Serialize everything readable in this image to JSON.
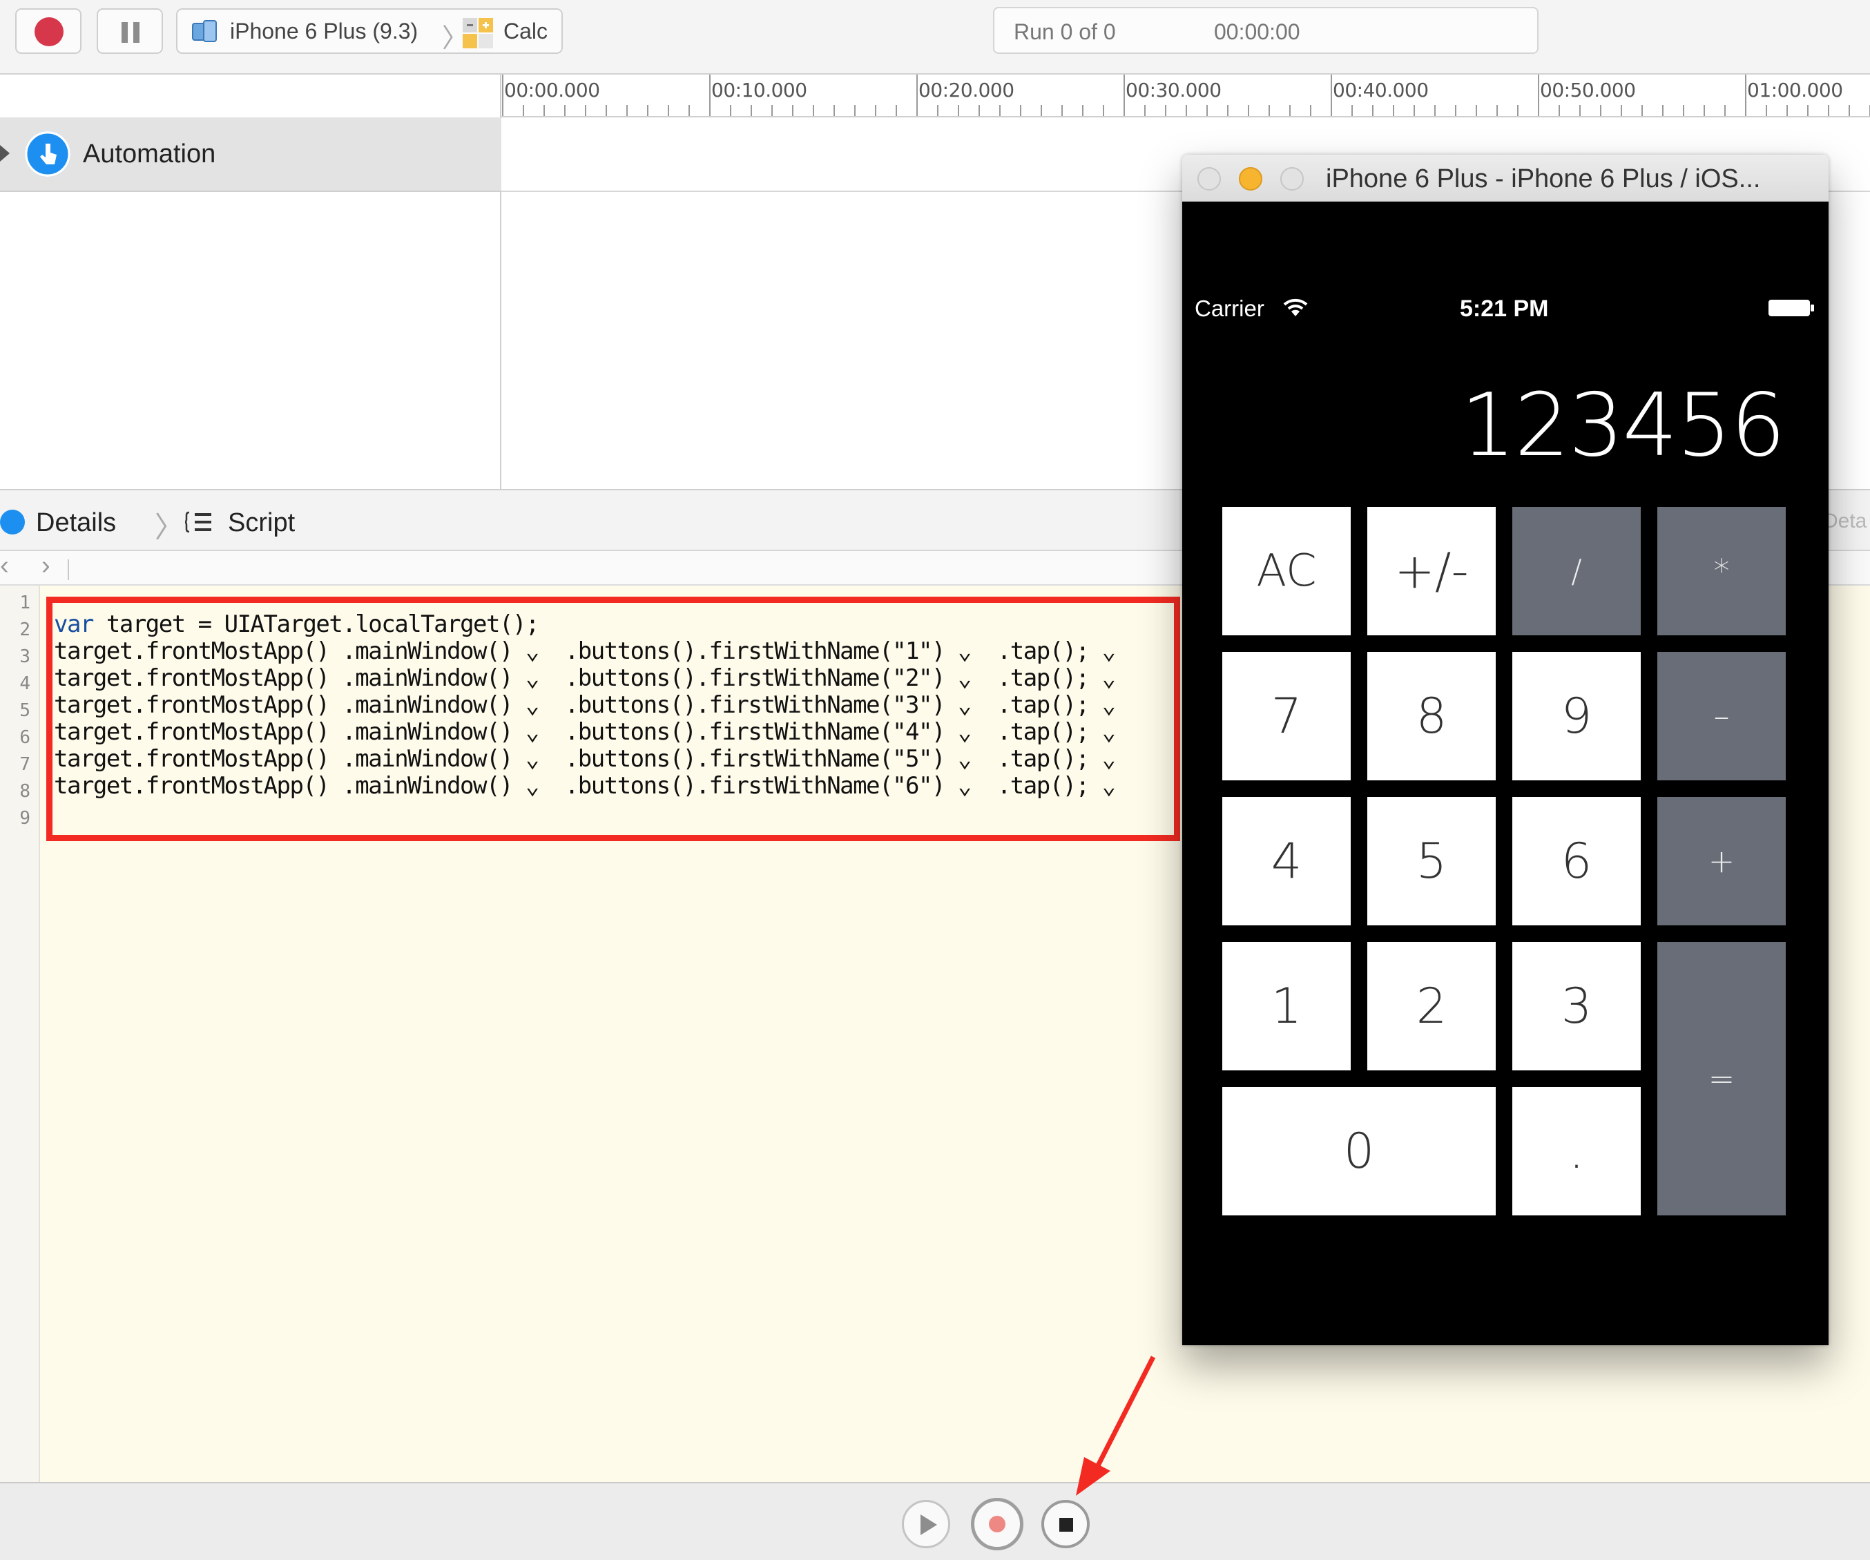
{
  "toolbar": {
    "device_label": "iPhone 6 Plus (9.3)",
    "app_label": "Calc",
    "separator": "〉",
    "run_status": "Run 0 of 0",
    "elapsed_time": "00:00:00"
  },
  "timeline": {
    "ticks": [
      "00:00.000",
      "00:10.000",
      "00:20.000",
      "00:30.000",
      "00:40.000",
      "00:50.000",
      "01:00.000"
    ],
    "instrument_label": "Automation"
  },
  "details_bar": {
    "details_label": "Details",
    "chevron": "〉",
    "script_label": "Script",
    "partial_right_label": "Deta",
    "back_glyph": "‹",
    "forward_glyph": "›"
  },
  "editor": {
    "line_numbers": [
      "1",
      "2",
      "3",
      "4",
      "5",
      "6",
      "7",
      "8",
      "9"
    ],
    "keyword": "var",
    "line2_rest": " target = UIATarget.localTarget();",
    "lines": [
      "target.frontMostApp() .mainWindow() ⌄  .buttons().firstWithName(\"1\") ⌄  .tap(); ⌄",
      "target.frontMostApp() .mainWindow() ⌄  .buttons().firstWithName(\"2\") ⌄  .tap(); ⌄",
      "target.frontMostApp() .mainWindow() ⌄  .buttons().firstWithName(\"3\") ⌄  .tap(); ⌄",
      "target.frontMostApp() .mainWindow() ⌄  .buttons().firstWithName(\"4\") ⌄  .tap(); ⌄",
      "target.frontMostApp() .mainWindow() ⌄  .buttons().firstWithName(\"5\") ⌄  .tap(); ⌄",
      "target.frontMostApp() .mainWindow() ⌄  .buttons().firstWithName(\"6\") ⌄  .tap(); ⌄"
    ]
  },
  "simulator": {
    "window_title": "iPhone 6 Plus - iPhone 6 Plus / iOS...",
    "carrier": "Carrier",
    "time": "5:21 PM",
    "display_value": "123456",
    "keys": {
      "ac": "AC",
      "sign": "+/-",
      "divide": "/",
      "multiply": "*",
      "k7": "7",
      "k8": "8",
      "k9": "9",
      "minus": "–",
      "k4": "4",
      "k5": "5",
      "k6": "6",
      "plus": "+",
      "k1": "1",
      "k2": "2",
      "k3": "3",
      "equals": "=",
      "k0": "0",
      "dot": "."
    }
  },
  "colors": {
    "record_red": "#d7374a",
    "highlight_red": "#f22a22",
    "operator_key": "#686d77",
    "editor_bg": "#fefbea",
    "accent_blue": "#1d8ff0"
  },
  "icons": [
    "record-icon",
    "pause-icon",
    "simulator-device-icon",
    "calc-app-icon",
    "automation-icon",
    "script-list-icon",
    "wifi-icon",
    "battery-icon",
    "play-icon",
    "stop-icon"
  ]
}
